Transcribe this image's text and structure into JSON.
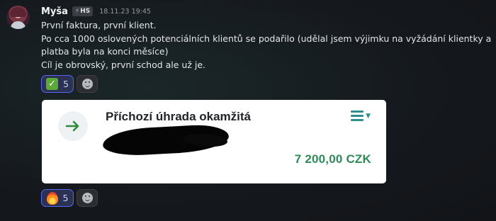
{
  "user": {
    "name": "Myša",
    "tag_label": "HS",
    "tag_icon": "lightning-icon",
    "timestamp": "18.11.23 19:45"
  },
  "message": {
    "lines": [
      "První faktura, první klient.",
      "Po cca 1000 oslovených potenciálních klientů se podařilo (udělal jsem výjimku na vyžádání klientky a",
      "platba byla na konci měsíce)",
      "Cíl je obrovský, první schod ale už je."
    ]
  },
  "reactions_top": {
    "emoji_icon": "check-mark-emoji",
    "count": "5",
    "add_icon": "smile-icon"
  },
  "card": {
    "title": "Příchozí úhrada okamžitá",
    "amount": "7 200,00 CZK",
    "arrow_icon": "arrow-right-icon",
    "menu_icon": "menu-icon",
    "chevron_icon": "chevron-down-icon",
    "accent_color": "#2e8b57"
  },
  "reactions_bottom": {
    "emoji_icon": "fire-emoji",
    "count": "5",
    "add_icon": "smile-icon"
  }
}
